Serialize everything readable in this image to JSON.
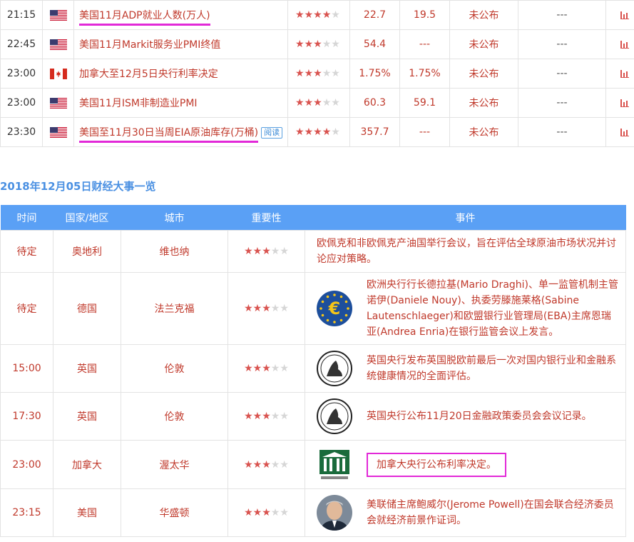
{
  "top_rows": [
    {
      "time": "21:15",
      "flag": "us",
      "event": "美国11月ADP就业人数(万人)",
      "highlight": true,
      "read": "",
      "stars": 4,
      "actual": "22.7",
      "forecast": "19.5",
      "status": "未公布",
      "impact": "---"
    },
    {
      "time": "22:45",
      "flag": "us",
      "event": "美国11月Markit服务业PMI终值",
      "highlight": false,
      "read": "",
      "stars": 3,
      "actual": "54.4",
      "forecast": "---",
      "status": "未公布",
      "impact": "---"
    },
    {
      "time": "23:00",
      "flag": "ca",
      "event": "加拿大至12月5日央行利率决定",
      "highlight": false,
      "read": "",
      "stars": 3,
      "actual": "1.75%",
      "forecast": "1.75%",
      "status": "未公布",
      "impact": "---"
    },
    {
      "time": "23:00",
      "flag": "us",
      "event": "美国11月ISM非制造业PMI",
      "highlight": false,
      "read": "",
      "stars": 3,
      "actual": "60.3",
      "forecast": "59.1",
      "status": "未公布",
      "impact": "---"
    },
    {
      "time": "23:30",
      "flag": "us",
      "event": "美国至11月30日当周EIA原油库存(万桶)",
      "highlight": true,
      "read": "阅读",
      "stars": 4,
      "actual": "357.7",
      "forecast": "---",
      "status": "未公布",
      "impact": "---"
    }
  ],
  "section_title": "2018年12月05日财经大事一览",
  "headers": {
    "time": "时间",
    "country": "国家/地区",
    "city": "城市",
    "importance": "重要性",
    "event": "事件"
  },
  "events": [
    {
      "time": "待定",
      "country": "奥地利",
      "city": "维也纳",
      "stars": 3,
      "logo": "",
      "text": "欧佩克和非欧佩克产油国举行会议，旨在评估全球原油市场状况并讨论应对策略。"
    },
    {
      "time": "待定",
      "country": "德国",
      "city": "法兰克福",
      "stars": 3,
      "logo": "ecb-euro-logo",
      "text": "欧洲央行行长德拉基(Mario Draghi)、单一监管机制主管诺伊(Daniele Nouy)、执委劳滕施莱格(Sabine Lautenschlaeger)和欧盟银行业管理局(EBA)主席恩瑞亚(Andrea Enria)在银行监管会议上发言。"
    },
    {
      "time": "15:00",
      "country": "英国",
      "city": "伦敦",
      "stars": 3,
      "logo": "boe-seal-logo",
      "text": "英国央行发布英国脱欧前最后一次对国内银行业和金融系统健康情况的全面评估。"
    },
    {
      "time": "17:30",
      "country": "英国",
      "city": "伦敦",
      "stars": 3,
      "logo": "boe-seal-logo",
      "text": "英国央行公布11月20日金融政策委员会会议记录。"
    },
    {
      "time": "23:00",
      "country": "加拿大",
      "city": "渥太华",
      "stars": 3,
      "logo": "boc-building-logo",
      "text": "加拿大央行公布利率决定。"
    },
    {
      "time": "23:15",
      "country": "美国",
      "city": "华盛顿",
      "stars": 3,
      "logo": "powell-portrait",
      "text": "美联储主席鲍威尔(Jerome Powell)在国会联合经济委员会就经济前景作证词。"
    }
  ],
  "colors": {
    "accent": "#5aa0f5",
    "red_text": "#c0392b",
    "highlight": "#e229d8",
    "star_on": "#d9534f",
    "star_off": "#d6d6d6"
  }
}
